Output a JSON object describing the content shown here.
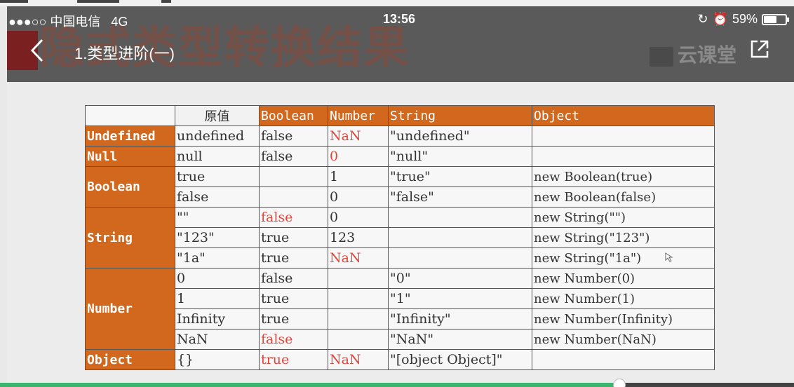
{
  "status_bar": {
    "carrier": "●●●○○ 中国电信",
    "network": "4G",
    "time": "13:56",
    "battery_text": "59%",
    "battery_level": 0.59
  },
  "nav": {
    "title": "1.类型进阶(一)",
    "brand": "云课堂"
  },
  "slide": {
    "title": "隐式类型转换结果"
  },
  "table": {
    "headers": [
      "原值",
      "Boolean",
      "Number",
      "String",
      "Object"
    ],
    "rowheads": [
      "Undefined",
      "Null",
      "Boolean",
      "String",
      "Number",
      "Object"
    ],
    "rows": [
      [
        "undefined",
        "false",
        "NaN",
        "\"undefined\"",
        ""
      ],
      [
        "null",
        "false",
        "0",
        "\"null\"",
        ""
      ],
      [
        "true",
        "",
        "1",
        "\"true\"",
        "new Boolean(true)"
      ],
      [
        "false",
        "",
        "0",
        "\"false\"",
        "new Boolean(false)"
      ],
      [
        "\"\"",
        "false",
        "0",
        "",
        "new String(\"\")"
      ],
      [
        "\"123\"",
        "true",
        "123",
        "",
        "new String(\"123\")"
      ],
      [
        "\"1a\"",
        "true",
        "NaN",
        "",
        "new String(\"1a\")"
      ],
      [
        "0",
        "false",
        "",
        "\"0\"",
        "new Number(0)"
      ],
      [
        "1",
        "true",
        "",
        "\"1\"",
        "new Number(1)"
      ],
      [
        "Infinity",
        "true",
        "",
        "\"Infinity\"",
        "new Number(Infinity)"
      ],
      [
        "NaN",
        "false",
        "",
        "\"NaN\"",
        "new Number(NaN)"
      ],
      [
        "{}",
        "true",
        "NaN",
        "\"[object Object]\"",
        ""
      ]
    ]
  },
  "colors": {
    "accent_orange": "#d2681e",
    "highlight_red": "#e2453a",
    "progress_green": "#3cb46e"
  },
  "player": {
    "progress": 0.78
  }
}
